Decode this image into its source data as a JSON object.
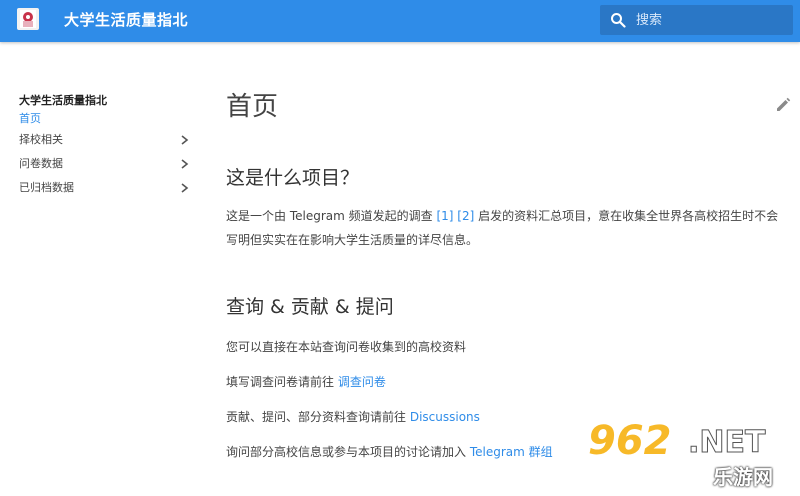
{
  "header": {
    "site_title": "大学生活质量指北",
    "search_placeholder": "搜索"
  },
  "sidebar": {
    "title": "大学生活质量指北",
    "items": [
      {
        "label": "首页",
        "active": true
      },
      {
        "label": "择校相关",
        "expandable": true
      },
      {
        "label": "问卷数据",
        "expandable": true
      },
      {
        "label": "已归档数据",
        "expandable": true
      }
    ]
  },
  "main": {
    "page_title": "首页",
    "section1": {
      "heading": "这是什么项目？",
      "text_before": "这是一个由 Telegram 频道发起的调查 ",
      "ref1": "[1]",
      "ref2": "[2]",
      "text_after": " 启发的资料汇总项目，意在收集全世界各高校招生时不会写明但实实在在影响大学生活质量的详尽信息。"
    },
    "section2": {
      "heading": "查询 & 贡献 & 提问",
      "p1": "您可以直接在本站查询问卷收集到的高校资料",
      "p2_text": "填写调查问卷请前往 ",
      "p2_link": "调查问卷",
      "p3_text": "贡献、提问、部分资料查询请前往 ",
      "p3_link": "Discussions",
      "p4_text": "询问部分高校信息或参与本项目的讨论请加入 ",
      "p4_link": "Telegram 群组"
    }
  },
  "watermark": {
    "number": "962",
    "suffix": ".NET",
    "subtitle": "乐游网"
  },
  "colors": {
    "header": "#2f8ce8",
    "search_bg": "#2a77c6",
    "link": "#2f8ce8"
  },
  "icons": [
    "site-logo",
    "search-icon",
    "chevron-right-icon",
    "edit-pencil-icon"
  ]
}
